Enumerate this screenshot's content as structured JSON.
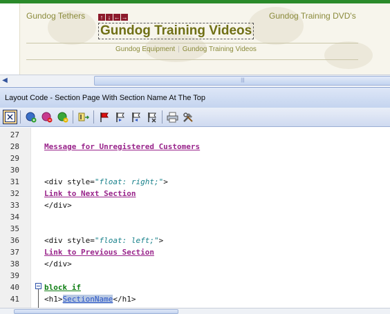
{
  "preview": {
    "left_link": "Gundog Tethers",
    "right_link": "Gundog Training DVD's",
    "edit_arrows": [
      "↑",
      "↓",
      "←",
      "→"
    ],
    "title": "Gundog Training Videos",
    "sub_links": [
      "Gundog Equipment",
      "Gundog Training Videos"
    ]
  },
  "scrollbar": {
    "left_arrow": "◀",
    "grip": "|||"
  },
  "panel": {
    "title": "Layout Code  - Section Page With Section Name At The Top"
  },
  "toolbar": {
    "buttons": [
      {
        "name": "design-view-icon",
        "active": true
      },
      {
        "name": "add-circle-icon"
      },
      {
        "name": "remove-circle-icon"
      },
      {
        "name": "refresh-circle-icon"
      },
      {
        "name": "insert-text-icon"
      },
      {
        "name": "set-bookmark-icon"
      },
      {
        "name": "next-bookmark-icon"
      },
      {
        "name": "previous-bookmark-icon"
      },
      {
        "name": "clear-bookmarks-icon"
      },
      {
        "name": "print-icon"
      },
      {
        "name": "tools-icon"
      }
    ]
  },
  "editor": {
    "lines": [
      {
        "num": "27",
        "text": ""
      },
      {
        "num": "28",
        "text": "Message for Unregistered Customers"
      },
      {
        "num": "29",
        "text": ""
      },
      {
        "num": "30",
        "text": ""
      },
      {
        "num": "31",
        "open": "<div",
        "attr": " style=",
        "val": "\"float: right;\"",
        "close": ">"
      },
      {
        "num": "32",
        "text": "Link to Next Section"
      },
      {
        "num": "33",
        "text": "</div>"
      },
      {
        "num": "34",
        "text": ""
      },
      {
        "num": "35",
        "text": ""
      },
      {
        "num": "36",
        "open": "<div",
        "attr": " style=",
        "val": "\"float: left;\"",
        "close": ">"
      },
      {
        "num": "37",
        "text": "Link to Previous Section"
      },
      {
        "num": "38",
        "text": "</div>"
      },
      {
        "num": "39",
        "text": ""
      },
      {
        "num": "40",
        "text": "block if"
      },
      {
        "num": "41",
        "h1_open": "<h1>",
        "selected": "SectionName",
        "h1_close": "</h1>"
      }
    ]
  }
}
